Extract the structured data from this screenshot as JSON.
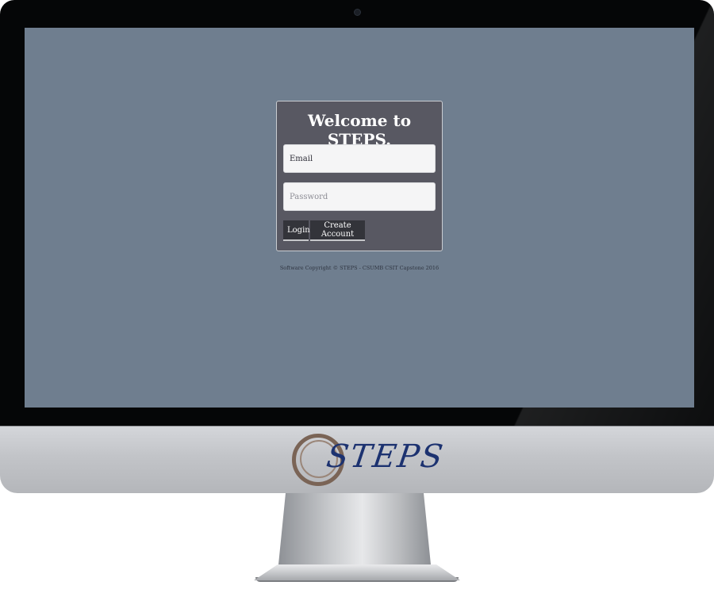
{
  "login": {
    "title": "Welcome to STEPS.",
    "email_value": "Email",
    "password_placeholder": "Password",
    "login_label": "Login",
    "create_account_label": "Create Account"
  },
  "footer": {
    "copyright": "Software Copyright © STEPS - CSUMB CSIT Capstone 2016"
  },
  "brand": {
    "logo_text": "STEPS"
  },
  "colors": {
    "screen_bg": "#6f7e8f",
    "panel_bg": "#585862",
    "button_bg": "#33343a",
    "logo_blue": "#1c3270",
    "logo_brown": "#7a6456"
  }
}
